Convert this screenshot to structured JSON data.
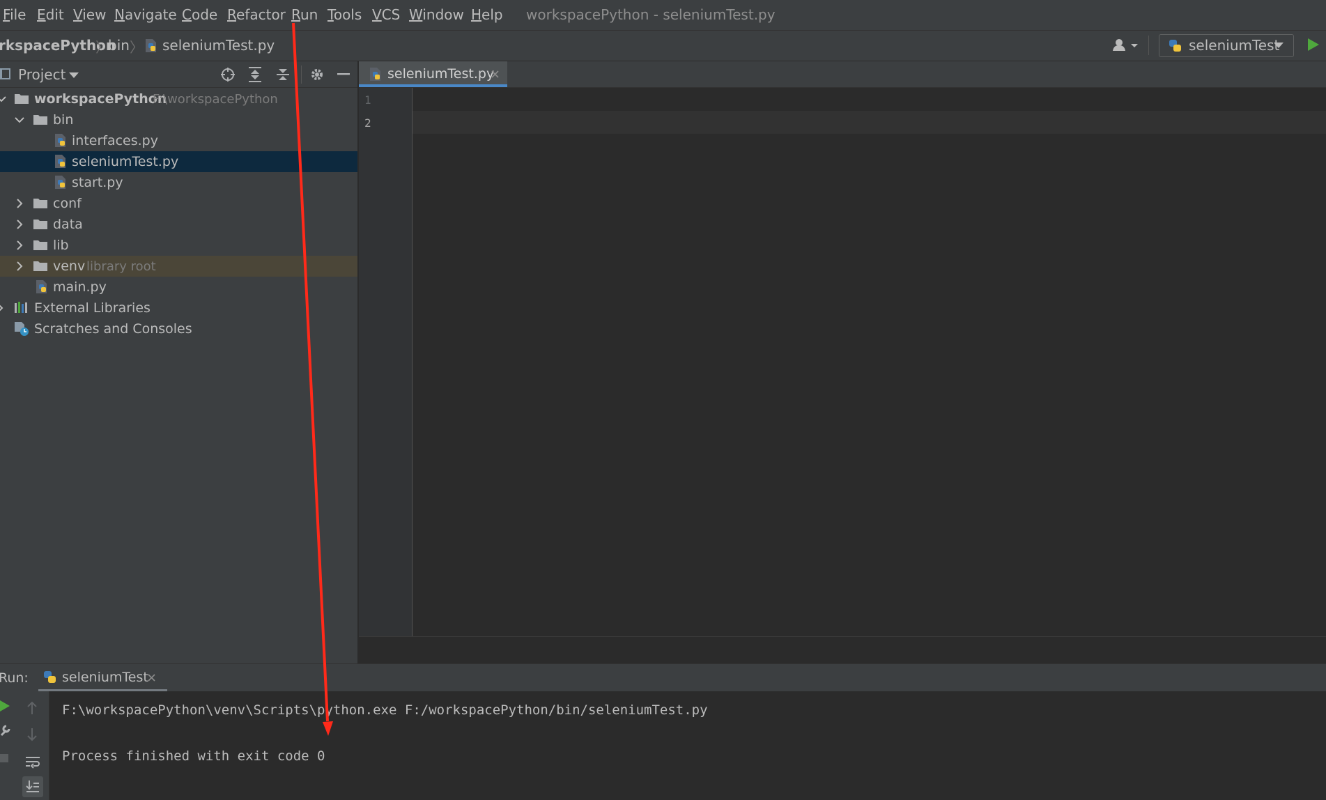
{
  "menu": {
    "items": [
      "File",
      "Edit",
      "View",
      "Navigate",
      "Code",
      "Refactor",
      "Run",
      "Tools",
      "VCS",
      "Window",
      "Help"
    ],
    "window_title": "workspacePython - seleniumTest.py"
  },
  "navbar": {
    "breadcrumbs": [
      "rkspacePython",
      "bin",
      "seleniumTest.py"
    ],
    "run_config": "seleniumTest"
  },
  "project": {
    "title": "Project",
    "tree": [
      {
        "label": "workspacePython",
        "hint": "F:\\workspacePython",
        "kind": "folder-open",
        "depth": 0,
        "bold": true
      },
      {
        "label": "bin",
        "kind": "folder-open",
        "depth": 1
      },
      {
        "label": "interfaces.py",
        "kind": "py",
        "depth": 2
      },
      {
        "label": "seleniumTest.py",
        "kind": "py",
        "depth": 2,
        "selected": true
      },
      {
        "label": "start.py",
        "kind": "py",
        "depth": 2
      },
      {
        "label": "conf",
        "kind": "folder-closed",
        "depth": 1
      },
      {
        "label": "data",
        "kind": "folder-closed",
        "depth": 1
      },
      {
        "label": "lib",
        "kind": "folder-closed",
        "depth": 1
      },
      {
        "label": "venv",
        "hint": "library root",
        "kind": "folder-closed",
        "depth": 1,
        "library": true
      },
      {
        "label": "main.py",
        "kind": "py",
        "depth": 1
      },
      {
        "label": "External Libraries",
        "kind": "libraries",
        "depth": 0
      },
      {
        "label": "Scratches and Consoles",
        "kind": "scratches",
        "depth": 0
      }
    ]
  },
  "editor": {
    "tab_label": "seleniumTest.py",
    "line_numbers": [
      "1",
      "2"
    ]
  },
  "run_panel": {
    "label": "Run:",
    "tab_label": "seleniumTest",
    "console": [
      "F:\\workspacePython\\venv\\Scripts\\python.exe F:/workspacePython/bin/seleniumTest.py",
      "",
      "Process finished with exit code 0"
    ]
  },
  "colors": {
    "annotation_arrow": "#ff2a1a",
    "accent": "#4a88c7",
    "run_green": "#4fa83d"
  }
}
